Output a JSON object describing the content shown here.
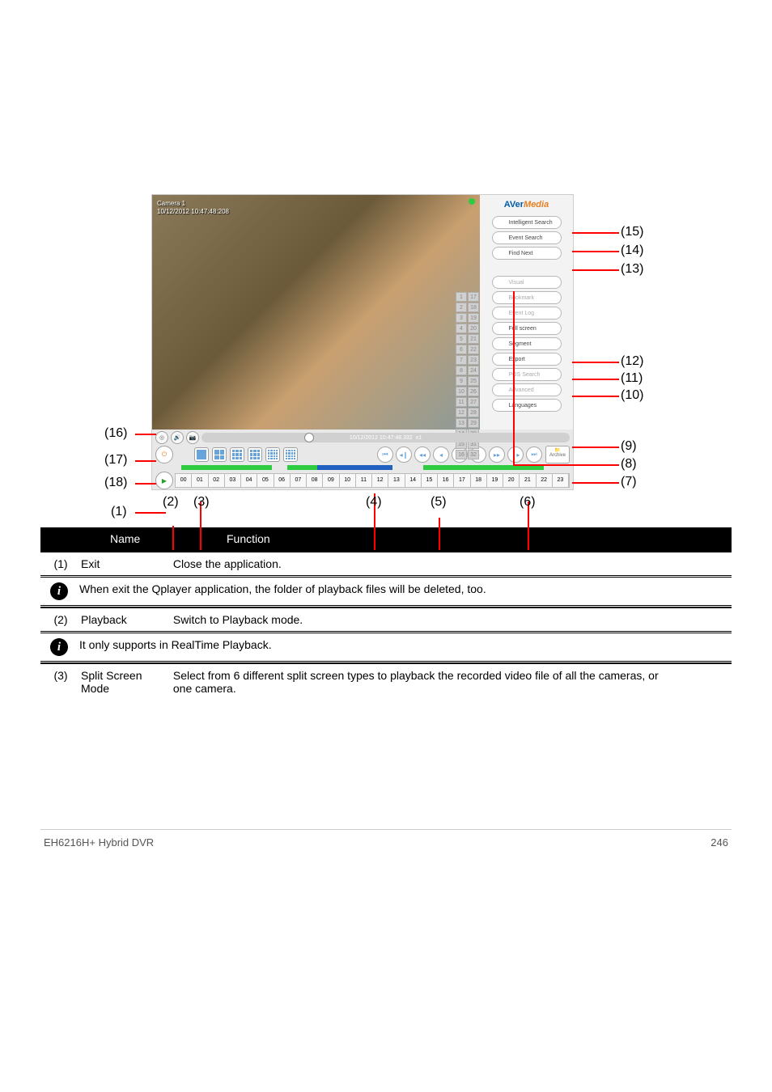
{
  "video": {
    "camera_label": "Camera 1",
    "timestamp_overlay": "10/12/2012 10:47:48:208"
  },
  "brand": {
    "aver": "AVer",
    "media": "Media"
  },
  "side_buttons": {
    "intelligent": "Intelligent Search",
    "event": "Event Search",
    "find_next": "Find Next",
    "visual": "Visual",
    "bookmark": "Bookmark",
    "event_log": "Event Log",
    "full_screen": "Full screen",
    "segment": "Segment",
    "export": "Export",
    "pos": "POS Search",
    "advanced": "Advanced",
    "languages": "Languages"
  },
  "camera_cells": [
    "1",
    "17",
    "2",
    "18",
    "3",
    "19",
    "4",
    "20",
    "5",
    "21",
    "6",
    "22",
    "7",
    "23",
    "8",
    "24",
    "9",
    "25",
    "10",
    "26",
    "11",
    "27",
    "12",
    "28",
    "13",
    "29",
    "14",
    "30",
    "15",
    "31",
    "16",
    "32"
  ],
  "status": {
    "position_text": "10/12/2012 10:47:48.332",
    "speed": "x1"
  },
  "archive_label": "Archive",
  "hours": [
    "00",
    "01",
    "02",
    "03",
    "04",
    "05",
    "06",
    "07",
    "08",
    "09",
    "10",
    "11",
    "12",
    "13",
    "14",
    "15",
    "16",
    "17",
    "18",
    "19",
    "20",
    "21",
    "22",
    "23"
  ],
  "right_markers": {
    "m15": "(15)",
    "m14": "(14)",
    "m13": "(13)",
    "m12": "(12)",
    "m11": "(11)",
    "m10": "(10)",
    "m9": "(9)",
    "m8": "(8)",
    "m7": "(7)"
  },
  "left_markers": {
    "m16": "(16)",
    "m17": "(17)",
    "m18": "(18)",
    "m1": "(1)"
  },
  "bottom_markers": {
    "m2": "(2)",
    "m3": "(3)",
    "m4": "(4)",
    "m5": "(5)",
    "m6": "(6)"
  },
  "table_header": {
    "name": "Name",
    "function": "Function"
  },
  "rows": {
    "r1": {
      "num": "(1)",
      "name": "Exit",
      "func": "Close the application."
    },
    "r1_note": "When exit the Qplayer application, the folder of playback files will be deleted, too.",
    "r2": {
      "num": "(2)",
      "name": "Playback",
      "func": "Switch to Playback mode."
    },
    "r2_note": "It only supports in RealTime Playback.",
    "r3": {
      "num": "(3)",
      "name": "Split Screen Mode",
      "func": "Select from 6 different split screen types to playback the recorded video file of all the cameras, or one camera."
    }
  },
  "footer": {
    "left": "EH6216H+ Hybrid DVR",
    "right": "246"
  }
}
